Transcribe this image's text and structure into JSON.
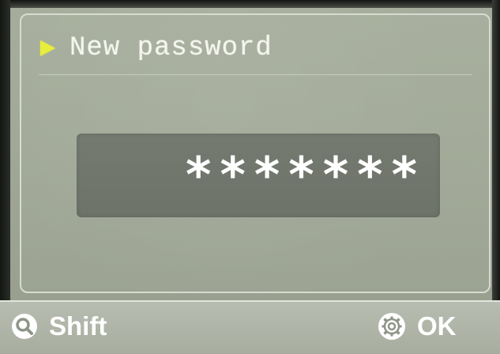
{
  "screen": {
    "title": "New password",
    "password_mask": "*******",
    "accent_color": "#e6ef3c"
  },
  "softkeys": {
    "left": {
      "icon": "magnifier-icon",
      "label": "Shift"
    },
    "right": {
      "icon": "gear-icon",
      "label": "OK"
    }
  }
}
